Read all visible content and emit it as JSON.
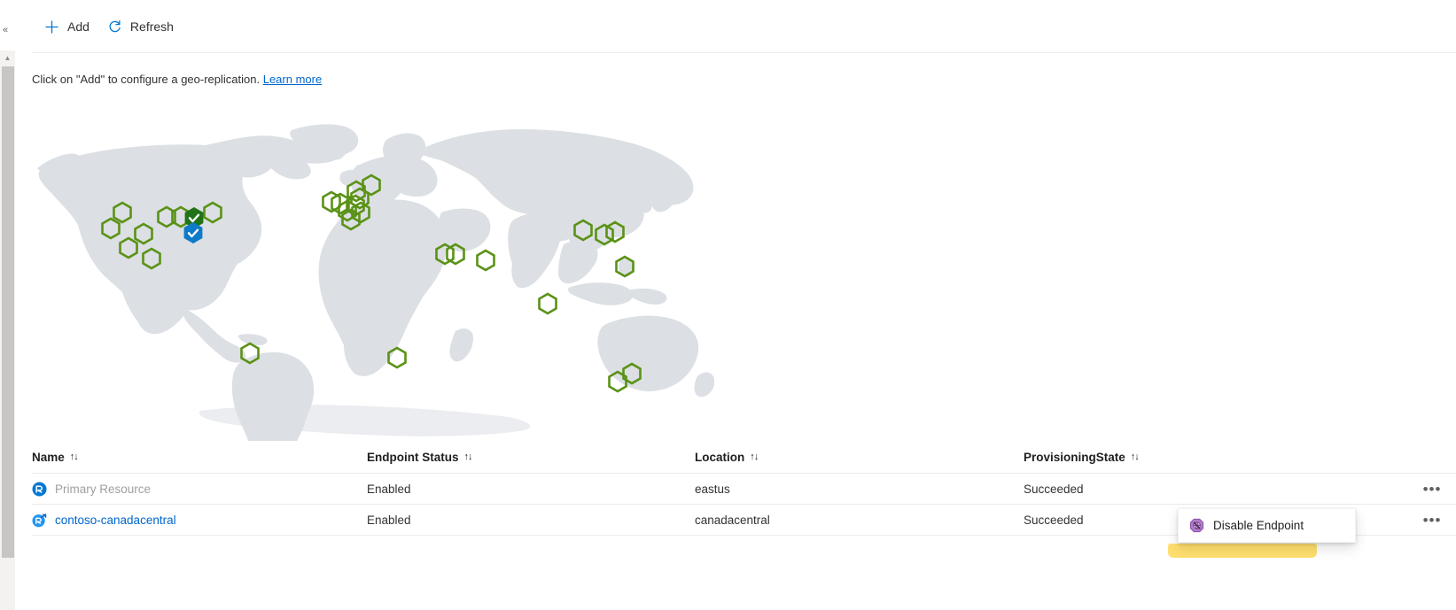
{
  "left_rail": {
    "collapse_icon": "chevron-left-icon",
    "collapse_label": "«",
    "scroll_up_label": "▲"
  },
  "command_bar": {
    "buttons": [
      {
        "label": "Add",
        "icon": "plus-icon"
      },
      {
        "label": "Refresh",
        "icon": "refresh-icon"
      }
    ]
  },
  "info": {
    "text": "Click on \"Add\" to configure a geo-replication.",
    "link_label": "Learn more",
    "link_color": "#0066cc"
  },
  "map": {
    "land_color": "#dcdfe3",
    "ocean_color": "#ffffff",
    "marker_outline_color": "#5a9216",
    "replica_fill_color": "#207317",
    "primary_fill_color": "#0f7ac8",
    "check_color": "#ffffff",
    "legend": {
      "available_region": "green-hexagon-outline",
      "replicated_region": "green-hexagon-check",
      "primary_region": "blue-hexagon-check"
    }
  },
  "table": {
    "columns": [
      {
        "label": "Name",
        "sort_icon": "↑↓"
      },
      {
        "label": "Endpoint Status",
        "sort_icon": "↑↓"
      },
      {
        "label": "Location",
        "sort_icon": "↑↓"
      },
      {
        "label": "ProvisioningState",
        "sort_icon": "↑↓"
      }
    ],
    "rows": [
      {
        "icon": "container-registry-icon",
        "name": "Primary Resource",
        "is_link": false,
        "endpoint_status": "Enabled",
        "location": "eastus",
        "provisioning_state": "Succeeded",
        "more_label": "•••"
      },
      {
        "icon": "container-registry-replica-icon",
        "name": "contoso-canadacentral",
        "is_link": true,
        "endpoint_status": "Enabled",
        "location": "canadacentral",
        "provisioning_state": "Succeeded",
        "more_label": "•••"
      }
    ]
  },
  "context_menu": {
    "items": [
      {
        "label": "Disable Endpoint",
        "icon": "disable-endpoint-icon"
      }
    ]
  },
  "annotation": {
    "highlighter_color": "#ffdf6e"
  }
}
